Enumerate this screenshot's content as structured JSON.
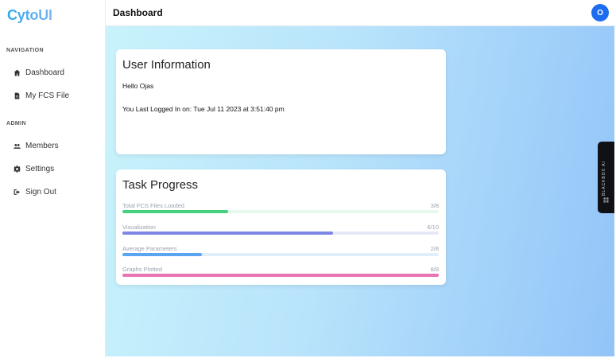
{
  "app": {
    "logo": "CytoUI"
  },
  "header": {
    "title": "Dashboard",
    "avatar_initial": "O"
  },
  "sidebar": {
    "sections": [
      {
        "title": "NAVIGATION"
      },
      {
        "title": "ADMIN"
      }
    ],
    "items": [
      {
        "label": "Dashboard",
        "icon": "home-icon"
      },
      {
        "label": "My FCS File",
        "icon": "file-icon"
      },
      {
        "label": "Members",
        "icon": "users-icon"
      },
      {
        "label": "Settings",
        "icon": "gear-icon"
      },
      {
        "label": "Sign Out",
        "icon": "sign-out-icon"
      }
    ]
  },
  "user_info": {
    "title": "User Information",
    "greeting": "Hello Ojas",
    "last_login": "You Last Logged In on: Tue Jul 11 2023 at 3:51:40 pm"
  },
  "task_progress": {
    "title": "Task Progress",
    "tasks": [
      {
        "label": "Total FCS Files Loaded",
        "value": "3/8",
        "fraction": 0.333,
        "color": "#46d17f",
        "track": "#e6f7ec"
      },
      {
        "label": "Visualization",
        "value": "6/10",
        "fraction": 0.667,
        "color": "#7d86e6",
        "track": "#e6e8f8"
      },
      {
        "label": "Average Parameters",
        "value": "2/8",
        "fraction": 0.25,
        "color": "#5aa5f0",
        "track": "#e1eefb"
      },
      {
        "label": "Graphs Plotted",
        "value": "8/8",
        "fraction": 1.0,
        "color": "#e874b1",
        "track": "#f8e3ee"
      }
    ]
  },
  "side_widget": {
    "label": "BLACKBOX AI"
  }
}
